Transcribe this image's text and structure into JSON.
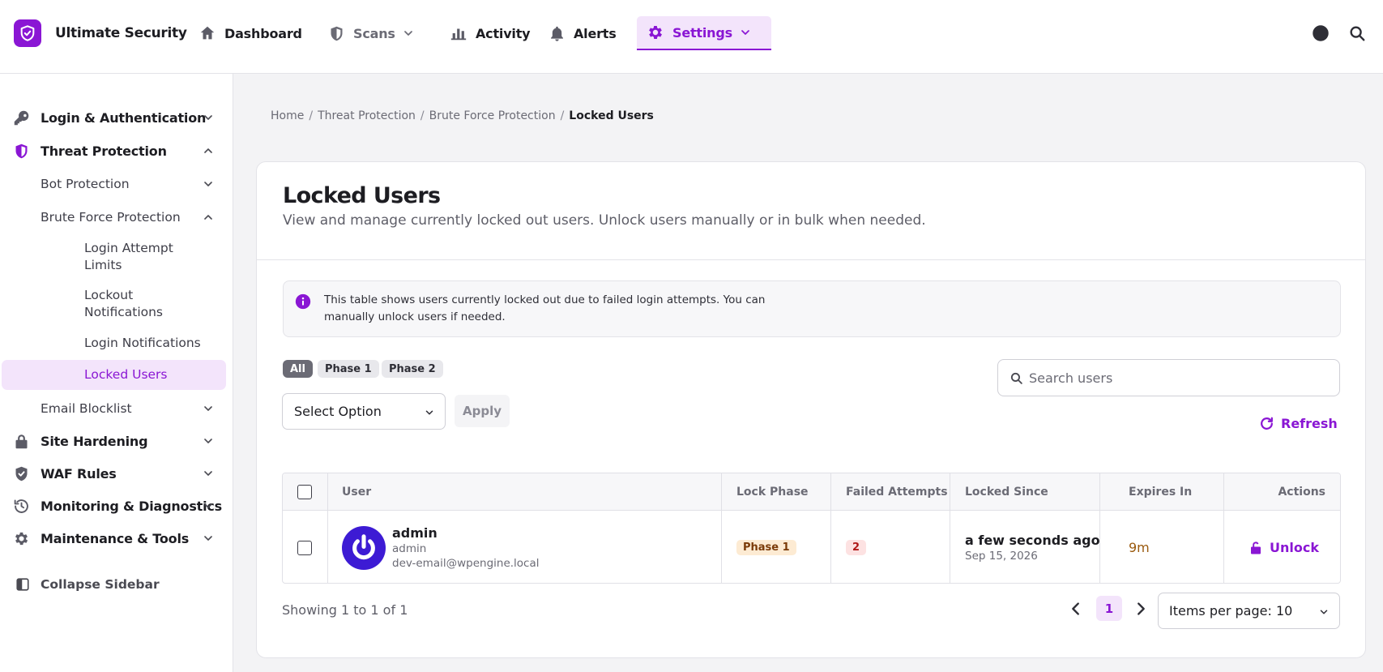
{
  "app": {
    "name": "Ultimate Security",
    "accent_color": "#8a16d4"
  },
  "topnav": {
    "items": [
      {
        "label": "Dashboard",
        "icon": "home-icon"
      },
      {
        "label": "Scans",
        "icon": "shield-icon"
      },
      {
        "label": "Activity",
        "icon": "bar-chart-icon"
      },
      {
        "label": "Alerts",
        "icon": "bell-icon"
      },
      {
        "label": "Settings",
        "icon": "gear-icon",
        "active": true
      }
    ],
    "right_icons": [
      "theme-toggle-icon",
      "search-icon"
    ]
  },
  "sidebar": {
    "sections": [
      {
        "label": "Login & Authentication",
        "icon": "key-icon",
        "expanded": false
      },
      {
        "label": "Threat Protection",
        "icon": "shield-icon",
        "expanded": true
      },
      {
        "label": "Site Hardening",
        "icon": "lock-icon",
        "expanded": false
      },
      {
        "label": "WAF Rules",
        "icon": "shield-check-icon",
        "expanded": false
      },
      {
        "label": "Monitoring & Diagnostics",
        "icon": "history-icon",
        "expanded": false
      },
      {
        "label": "Maintenance & Tools",
        "icon": "gear-icon",
        "expanded": false
      }
    ],
    "threat_items": [
      {
        "label": "Bot Protection"
      },
      {
        "label": "Brute Force Protection"
      },
      {
        "label": "Email Blocklist"
      }
    ],
    "brute_force_items": [
      {
        "label": "Login Attempt Limits"
      },
      {
        "label": "Lockout Notifications"
      },
      {
        "label": "Login Notifications"
      },
      {
        "label": "Locked Users",
        "selected": true
      }
    ],
    "collapse_label": "Collapse Sidebar"
  },
  "breadcrumb": {
    "items": [
      "Home",
      "Threat Protection",
      "Brute Force Protection"
    ],
    "current": "Locked Users",
    "separator": "/"
  },
  "page": {
    "title": "Locked Users",
    "description": "View and manage currently locked out users. Unlock users manually or in bulk when needed.",
    "info": "This table shows users currently locked out due to failed login attempts. You can manually unlock users if needed."
  },
  "filters": {
    "pills": [
      "All",
      "Phase 1",
      "Phase 2"
    ],
    "active": "All",
    "bulk_select": "Select Option",
    "apply_label": "Apply",
    "search_placeholder": "Search users",
    "refresh_label": "Refresh"
  },
  "table": {
    "columns": [
      "User",
      "Lock Phase",
      "Failed Attempts",
      "Locked Since",
      "Expires In",
      "Actions"
    ],
    "rows": [
      {
        "name": "admin",
        "username": "admin",
        "email": "dev-email@wpengine.local",
        "lock_phase": "Phase 1",
        "failed_attempts": "2",
        "locked_since": "a few seconds ago",
        "locked_date": "Sep 15, 2026",
        "expires_in": "9m",
        "action": "Unlock"
      }
    ]
  },
  "pagination": {
    "showing": "Showing 1 to 1 of 1",
    "current_page": "1",
    "items_per_page": "Items per page: 10"
  }
}
